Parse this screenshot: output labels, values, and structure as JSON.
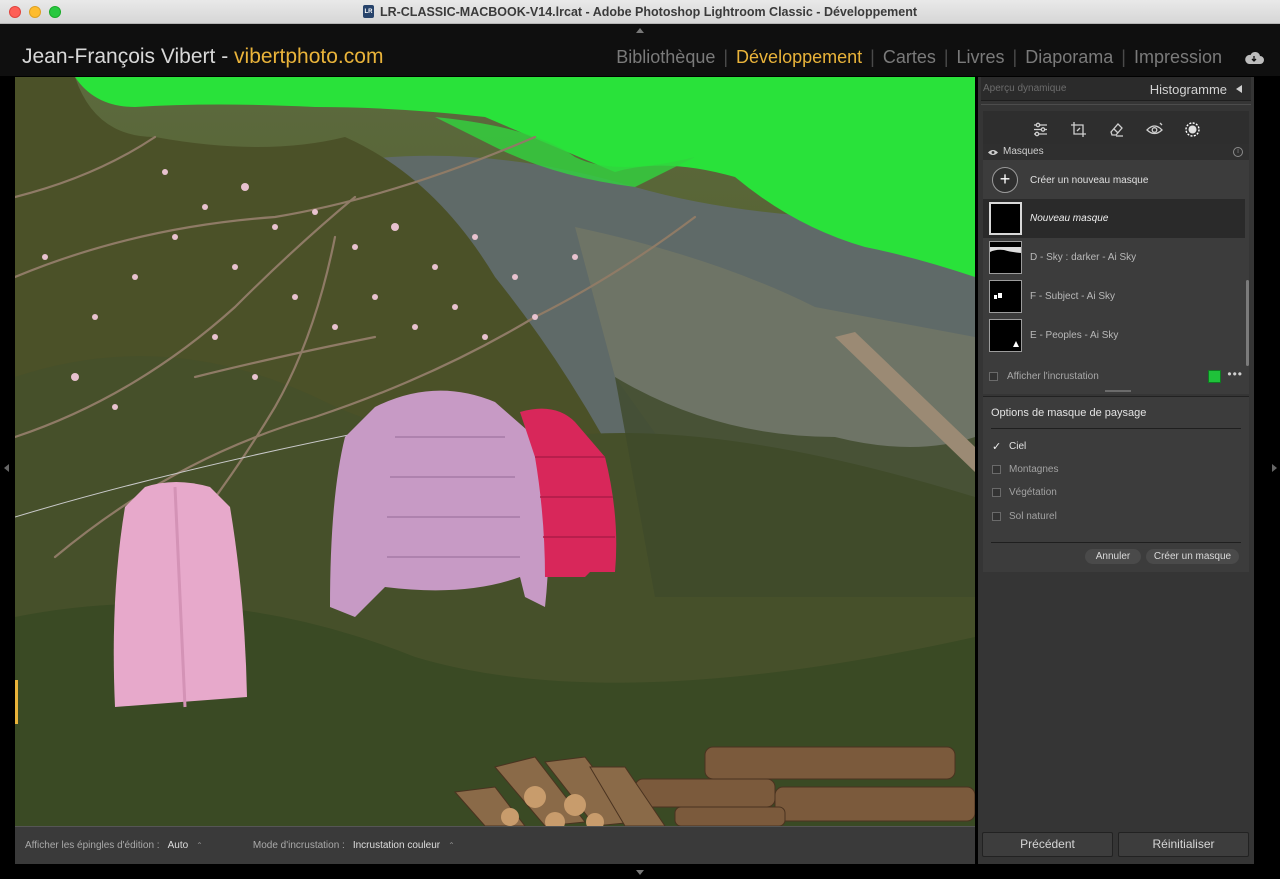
{
  "window": {
    "title": "LR-CLASSIC-MACBOOK-V14.lrcat - Adobe Photoshop Lightroom Classic - Développement",
    "doc_icon": "LR"
  },
  "identity": {
    "name": "Jean-François Vibert - ",
    "site": "vibertphoto.com"
  },
  "modules": [
    {
      "label": "Bibliothèque",
      "active": false
    },
    {
      "label": "Développement",
      "active": true
    },
    {
      "label": "Cartes",
      "active": false
    },
    {
      "label": "Livres",
      "active": false
    },
    {
      "label": "Diaporama",
      "active": false
    },
    {
      "label": "Impression",
      "active": false
    }
  ],
  "module_separator": "|",
  "toolbar": {
    "pins_label": "Afficher les épingles d'édition :",
    "pins_value": "Auto",
    "overlay_mode_label": "Mode d'incrustation :",
    "overlay_mode_value": "Incrustation couleur",
    "caret": "⌃"
  },
  "histogram": {
    "preview_label": "Aperçu dynamique",
    "title": "Histogramme"
  },
  "tools": [
    "edit-sliders-icon",
    "crop-icon",
    "eraser-icon",
    "redeye-icon",
    "masking-icon"
  ],
  "masks": {
    "title": "Masques",
    "info": "i",
    "create_plus": "+",
    "create_label": "Créer un nouveau masque",
    "items": [
      {
        "name": "Nouveau masque",
        "selected": true
      },
      {
        "name": "D - Sky : darker - Ai Sky",
        "selected": false
      },
      {
        "name": "F - Subject - Ai Sky",
        "selected": false
      },
      {
        "name": "E - Peoples - Ai Sky",
        "selected": false
      }
    ],
    "overlay_label": "Afficher l'incrustation",
    "overlay_color": "#1fc23a",
    "more": "•••"
  },
  "landscape_options": {
    "title": "Options de masque de paysage",
    "checkmark": "✓",
    "items": [
      {
        "label": "Ciel",
        "checked": true
      },
      {
        "label": "Montagnes",
        "checked": false
      },
      {
        "label": "Végétation",
        "checked": false
      },
      {
        "label": "Sol naturel",
        "checked": false
      }
    ],
    "cancel": "Annuler",
    "create": "Créer un masque"
  },
  "footer": {
    "previous": "Précédent",
    "reset": "Réinitialiser"
  }
}
